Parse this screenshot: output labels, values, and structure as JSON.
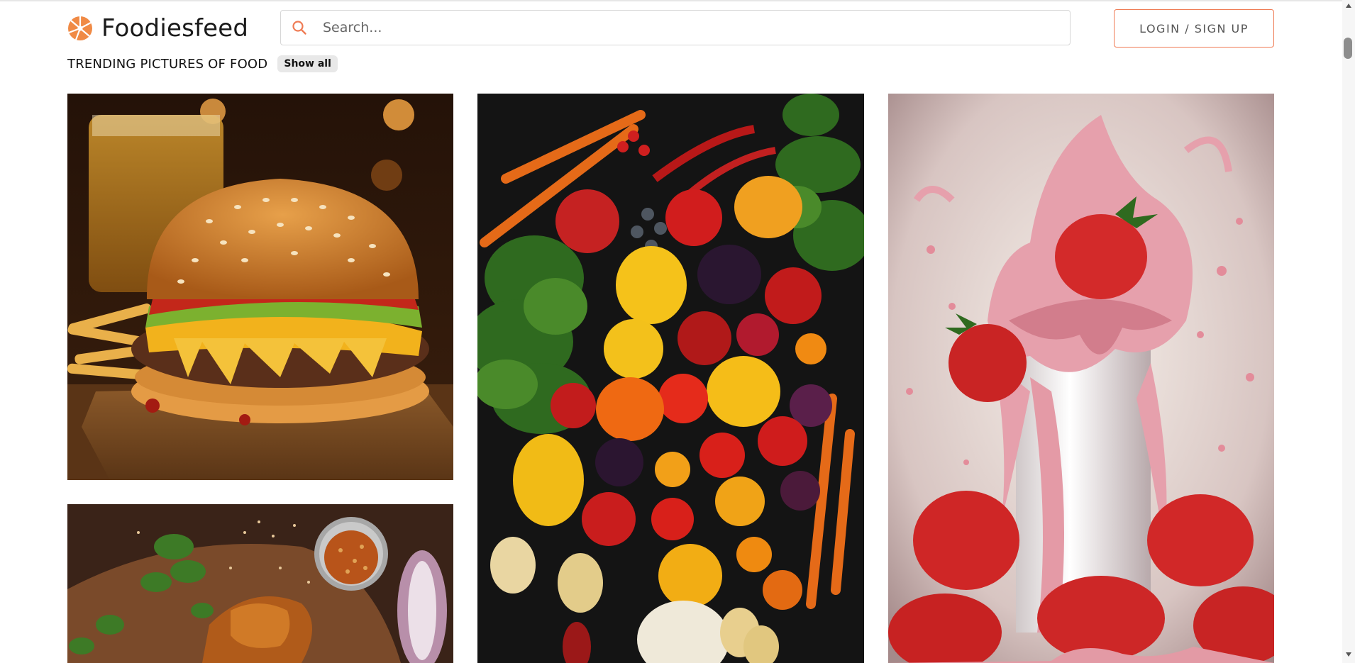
{
  "header": {
    "logo_text": "Foodiesfeed",
    "logo_icon": "foodiesfeed-logo-icon",
    "search_placeholder": "Search...",
    "search_icon": "search-icon",
    "login_label": "LOGIN / SIGN UP"
  },
  "trending": {
    "title": "TRENDING PICTURES OF FOOD",
    "show_all_label": "Show all"
  },
  "colors": {
    "accent": "#ef7b54",
    "logo_orange": "#f08a45"
  },
  "gallery": {
    "photos": [
      {
        "subject": "burger-photo"
      },
      {
        "subject": "vegetables-photo"
      },
      {
        "subject": "strawberry-milkshake-photo"
      },
      {
        "subject": "fried-chicken-photo"
      }
    ]
  }
}
